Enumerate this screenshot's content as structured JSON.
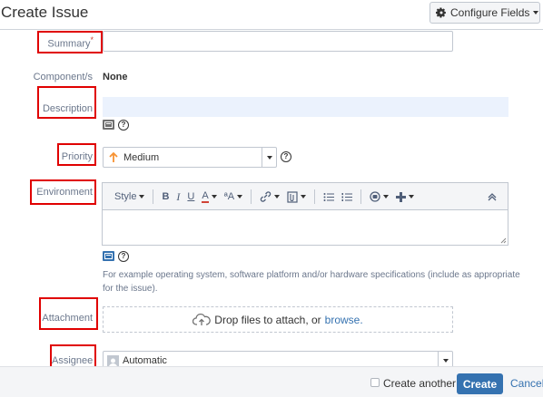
{
  "header": {
    "title": "Create Issue",
    "configure_label": "Configure Fields"
  },
  "fields": {
    "summary_label": "Summary",
    "summary_required": "*",
    "summary_value": "",
    "components_label": "Component/s",
    "components_value": "None",
    "description_label": "Description",
    "priority_label": "Priority",
    "priority_value": "Medium",
    "environment_label": "Environment",
    "environment_hint": "For example operating system, software platform and/or hardware specifications (include as appropriate for the issue).",
    "attachment_label": "Attachment",
    "attachment_drop_text": "Drop files to attach, or",
    "attachment_browse": "browse.",
    "assignee_label": "Assignee",
    "assignee_value": "Automatic"
  },
  "toolbar": {
    "style_label": "Style",
    "bold": "B",
    "italic": "I",
    "underline": "U",
    "text_color": "A",
    "text_effects": "ªA"
  },
  "footer": {
    "create_another_label": "Create another",
    "create_another_checked": false,
    "create_label": "Create",
    "cancel_label": "Cancel"
  },
  "colors": {
    "accent": "#3572b0",
    "highlight": "#e00000",
    "focus_bg": "#ebf2fd",
    "priority_arrow": "#f79232"
  },
  "icons": [
    "gear-icon",
    "wiki-preview-icon",
    "help-icon",
    "priority-arrow-icon",
    "upload-cloud-icon",
    "avatar-icon"
  ]
}
